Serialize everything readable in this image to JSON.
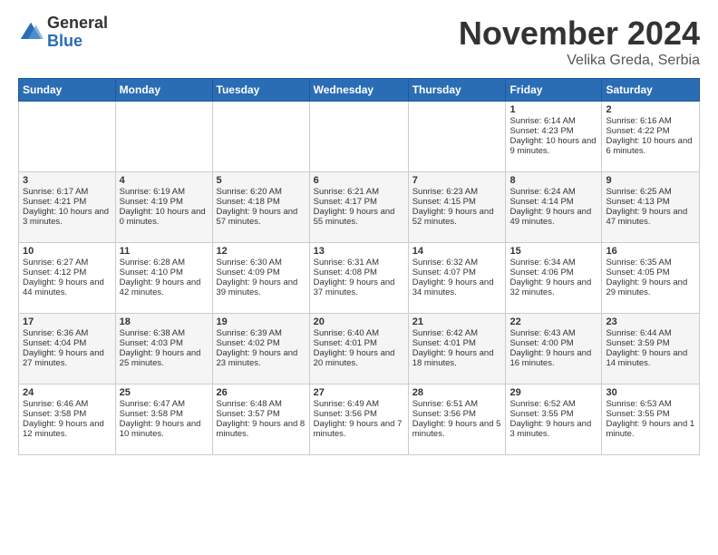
{
  "header": {
    "logo_general": "General",
    "logo_blue": "Blue",
    "month_title": "November 2024",
    "subtitle": "Velika Greda, Serbia"
  },
  "weekdays": [
    "Sunday",
    "Monday",
    "Tuesday",
    "Wednesday",
    "Thursday",
    "Friday",
    "Saturday"
  ],
  "weeks": [
    [
      {
        "day": "",
        "sunrise": "",
        "sunset": "",
        "daylight": ""
      },
      {
        "day": "",
        "sunrise": "",
        "sunset": "",
        "daylight": ""
      },
      {
        "day": "",
        "sunrise": "",
        "sunset": "",
        "daylight": ""
      },
      {
        "day": "",
        "sunrise": "",
        "sunset": "",
        "daylight": ""
      },
      {
        "day": "",
        "sunrise": "",
        "sunset": "",
        "daylight": ""
      },
      {
        "day": "1",
        "sunrise": "Sunrise: 6:14 AM",
        "sunset": "Sunset: 4:23 PM",
        "daylight": "Daylight: 10 hours and 9 minutes."
      },
      {
        "day": "2",
        "sunrise": "Sunrise: 6:16 AM",
        "sunset": "Sunset: 4:22 PM",
        "daylight": "Daylight: 10 hours and 6 minutes."
      }
    ],
    [
      {
        "day": "3",
        "sunrise": "Sunrise: 6:17 AM",
        "sunset": "Sunset: 4:21 PM",
        "daylight": "Daylight: 10 hours and 3 minutes."
      },
      {
        "day": "4",
        "sunrise": "Sunrise: 6:19 AM",
        "sunset": "Sunset: 4:19 PM",
        "daylight": "Daylight: 10 hours and 0 minutes."
      },
      {
        "day": "5",
        "sunrise": "Sunrise: 6:20 AM",
        "sunset": "Sunset: 4:18 PM",
        "daylight": "Daylight: 9 hours and 57 minutes."
      },
      {
        "day": "6",
        "sunrise": "Sunrise: 6:21 AM",
        "sunset": "Sunset: 4:17 PM",
        "daylight": "Daylight: 9 hours and 55 minutes."
      },
      {
        "day": "7",
        "sunrise": "Sunrise: 6:23 AM",
        "sunset": "Sunset: 4:15 PM",
        "daylight": "Daylight: 9 hours and 52 minutes."
      },
      {
        "day": "8",
        "sunrise": "Sunrise: 6:24 AM",
        "sunset": "Sunset: 4:14 PM",
        "daylight": "Daylight: 9 hours and 49 minutes."
      },
      {
        "day": "9",
        "sunrise": "Sunrise: 6:25 AM",
        "sunset": "Sunset: 4:13 PM",
        "daylight": "Daylight: 9 hours and 47 minutes."
      }
    ],
    [
      {
        "day": "10",
        "sunrise": "Sunrise: 6:27 AM",
        "sunset": "Sunset: 4:12 PM",
        "daylight": "Daylight: 9 hours and 44 minutes."
      },
      {
        "day": "11",
        "sunrise": "Sunrise: 6:28 AM",
        "sunset": "Sunset: 4:10 PM",
        "daylight": "Daylight: 9 hours and 42 minutes."
      },
      {
        "day": "12",
        "sunrise": "Sunrise: 6:30 AM",
        "sunset": "Sunset: 4:09 PM",
        "daylight": "Daylight: 9 hours and 39 minutes."
      },
      {
        "day": "13",
        "sunrise": "Sunrise: 6:31 AM",
        "sunset": "Sunset: 4:08 PM",
        "daylight": "Daylight: 9 hours and 37 minutes."
      },
      {
        "day": "14",
        "sunrise": "Sunrise: 6:32 AM",
        "sunset": "Sunset: 4:07 PM",
        "daylight": "Daylight: 9 hours and 34 minutes."
      },
      {
        "day": "15",
        "sunrise": "Sunrise: 6:34 AM",
        "sunset": "Sunset: 4:06 PM",
        "daylight": "Daylight: 9 hours and 32 minutes."
      },
      {
        "day": "16",
        "sunrise": "Sunrise: 6:35 AM",
        "sunset": "Sunset: 4:05 PM",
        "daylight": "Daylight: 9 hours and 29 minutes."
      }
    ],
    [
      {
        "day": "17",
        "sunrise": "Sunrise: 6:36 AM",
        "sunset": "Sunset: 4:04 PM",
        "daylight": "Daylight: 9 hours and 27 minutes."
      },
      {
        "day": "18",
        "sunrise": "Sunrise: 6:38 AM",
        "sunset": "Sunset: 4:03 PM",
        "daylight": "Daylight: 9 hours and 25 minutes."
      },
      {
        "day": "19",
        "sunrise": "Sunrise: 6:39 AM",
        "sunset": "Sunset: 4:02 PM",
        "daylight": "Daylight: 9 hours and 23 minutes."
      },
      {
        "day": "20",
        "sunrise": "Sunrise: 6:40 AM",
        "sunset": "Sunset: 4:01 PM",
        "daylight": "Daylight: 9 hours and 20 minutes."
      },
      {
        "day": "21",
        "sunrise": "Sunrise: 6:42 AM",
        "sunset": "Sunset: 4:01 PM",
        "daylight": "Daylight: 9 hours and 18 minutes."
      },
      {
        "day": "22",
        "sunrise": "Sunrise: 6:43 AM",
        "sunset": "Sunset: 4:00 PM",
        "daylight": "Daylight: 9 hours and 16 minutes."
      },
      {
        "day": "23",
        "sunrise": "Sunrise: 6:44 AM",
        "sunset": "Sunset: 3:59 PM",
        "daylight": "Daylight: 9 hours and 14 minutes."
      }
    ],
    [
      {
        "day": "24",
        "sunrise": "Sunrise: 6:46 AM",
        "sunset": "Sunset: 3:58 PM",
        "daylight": "Daylight: 9 hours and 12 minutes."
      },
      {
        "day": "25",
        "sunrise": "Sunrise: 6:47 AM",
        "sunset": "Sunset: 3:58 PM",
        "daylight": "Daylight: 9 hours and 10 minutes."
      },
      {
        "day": "26",
        "sunrise": "Sunrise: 6:48 AM",
        "sunset": "Sunset: 3:57 PM",
        "daylight": "Daylight: 9 hours and 8 minutes."
      },
      {
        "day": "27",
        "sunrise": "Sunrise: 6:49 AM",
        "sunset": "Sunset: 3:56 PM",
        "daylight": "Daylight: 9 hours and 7 minutes."
      },
      {
        "day": "28",
        "sunrise": "Sunrise: 6:51 AM",
        "sunset": "Sunset: 3:56 PM",
        "daylight": "Daylight: 9 hours and 5 minutes."
      },
      {
        "day": "29",
        "sunrise": "Sunrise: 6:52 AM",
        "sunset": "Sunset: 3:55 PM",
        "daylight": "Daylight: 9 hours and 3 minutes."
      },
      {
        "day": "30",
        "sunrise": "Sunrise: 6:53 AM",
        "sunset": "Sunset: 3:55 PM",
        "daylight": "Daylight: 9 hours and 1 minute."
      }
    ]
  ]
}
